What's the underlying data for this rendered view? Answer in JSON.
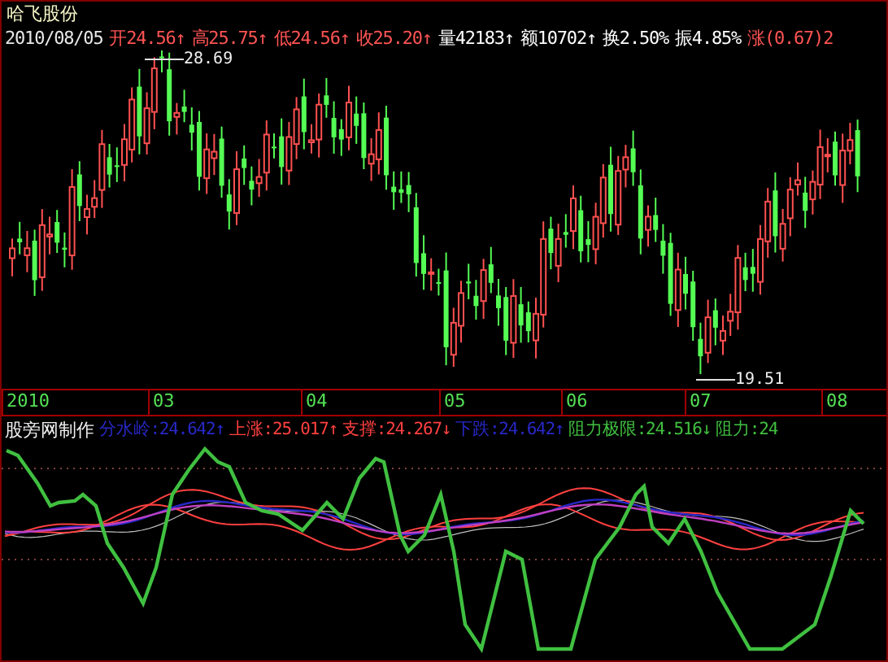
{
  "stock_name": "哈飞股份",
  "quote": {
    "date": "2010/08/05",
    "items": [
      {
        "label": "开",
        "value": "24.56",
        "arrow": "↑",
        "color": "#ff5454"
      },
      {
        "label": "高",
        "value": "25.75",
        "arrow": "↑",
        "color": "#ff5454"
      },
      {
        "label": "低",
        "value": "24.56",
        "arrow": "↑",
        "color": "#ff5454"
      },
      {
        "label": "收",
        "value": "25.20",
        "arrow": "↑",
        "color": "#ff5454"
      },
      {
        "label": "量",
        "value": "42183",
        "arrow": "↑",
        "color": "#ffffff"
      },
      {
        "label": "额",
        "value": "10702",
        "arrow": "↑",
        "color": "#ffffff"
      },
      {
        "label": "换",
        "value": "2.50%",
        "color": "#ffffff"
      },
      {
        "label": "振",
        "value": "4.85%",
        "color": "#ffffff"
      },
      {
        "label": "涨",
        "value": "(0.67)2",
        "color": "#ff5454"
      }
    ]
  },
  "price_labels": [
    {
      "kind": "high",
      "text": "28.69"
    },
    {
      "kind": "low",
      "text": "19.51"
    }
  ],
  "time_axis": [
    "2010",
    "03",
    "04",
    "05",
    "06",
    "07",
    "08"
  ],
  "indicator": {
    "title": "股旁网制作",
    "items": [
      {
        "label": "分水岭:",
        "value": "24.642",
        "arrow": "↑",
        "color": "#2828c8"
      },
      {
        "label": "上涨:",
        "value": "25.017",
        "arrow": "↑",
        "color": "#ff4040"
      },
      {
        "label": "支撑:",
        "value": "24.267",
        "arrow": "↓",
        "color": "#ff4040"
      },
      {
        "label": "下跌:",
        "value": "24.642",
        "arrow": "↑",
        "color": "#2828c8"
      },
      {
        "label": "阻力极限:",
        "value": "24.516",
        "arrow": "↓",
        "color": "#40c040"
      },
      {
        "label": "阻力:",
        "value": "24",
        "color": "#40c040"
      }
    ]
  }
}
